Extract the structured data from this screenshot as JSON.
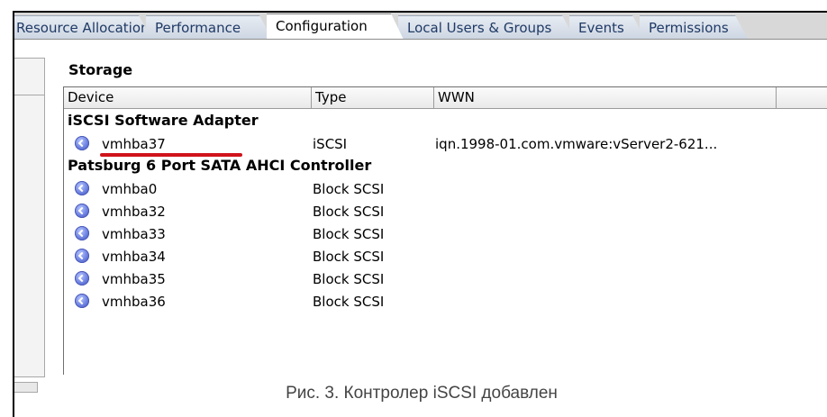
{
  "tabs": [
    {
      "label": "Resource Allocation",
      "active": false
    },
    {
      "label": "Performance",
      "active": false
    },
    {
      "label": "Configuration",
      "active": true
    },
    {
      "label": "Local Users & Groups",
      "active": false
    },
    {
      "label": "Events",
      "active": false
    },
    {
      "label": "Permissions",
      "active": false
    }
  ],
  "storage": {
    "title": "Storage",
    "columns": [
      "Device",
      "Type",
      "WWN"
    ],
    "groups": [
      {
        "name": "iSCSI Software Adapter",
        "rows": [
          {
            "device": "vmhba37",
            "type": "iSCSI",
            "wwn": "iqn.1998-01.com.vmware:vServer2-621...",
            "icon": "adapter-icon",
            "highlighted": true
          }
        ]
      },
      {
        "name": "Patsburg 6 Port SATA AHCI Controller",
        "rows": [
          {
            "device": "vmhba0",
            "type": "Block SCSI",
            "wwn": "",
            "icon": "adapter-icon"
          },
          {
            "device": "vmhba32",
            "type": "Block SCSI",
            "wwn": "",
            "icon": "adapter-icon"
          },
          {
            "device": "vmhba33",
            "type": "Block SCSI",
            "wwn": "",
            "icon": "adapter-icon"
          },
          {
            "device": "vmhba34",
            "type": "Block SCSI",
            "wwn": "",
            "icon": "adapter-icon"
          },
          {
            "device": "vmhba35",
            "type": "Block SCSI",
            "wwn": "",
            "icon": "adapter-icon"
          },
          {
            "device": "vmhba36",
            "type": "Block SCSI",
            "wwn": "",
            "icon": "adapter-icon"
          }
        ]
      }
    ]
  },
  "caption": "Рис. 3. Контролер iSCSI добавлен",
  "colors": {
    "highlight_underline": "#d0131b",
    "tab_text": "#1f3a66",
    "adapter_icon": "#6b7fe0"
  }
}
